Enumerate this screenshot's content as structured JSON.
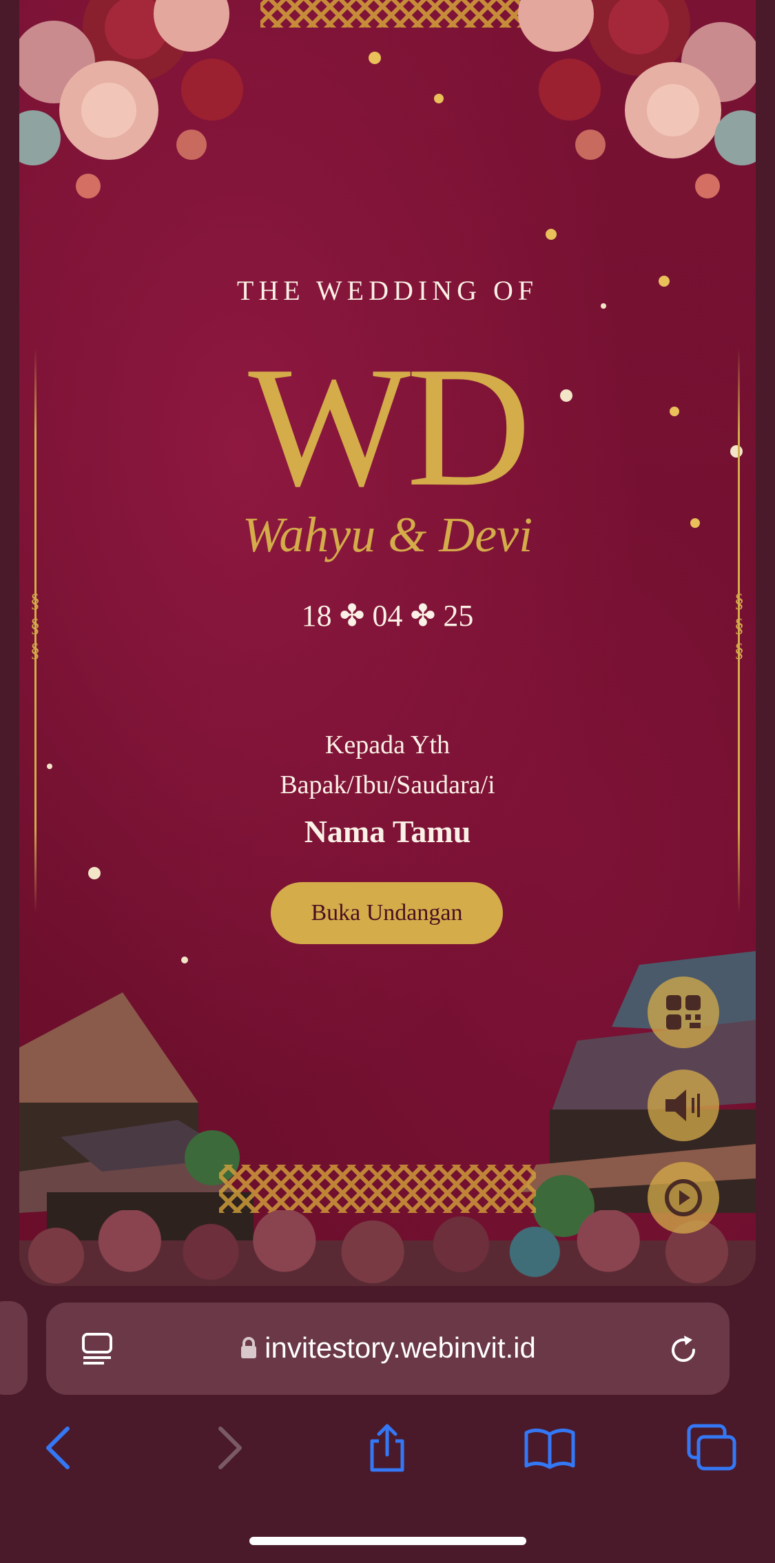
{
  "invitation": {
    "title": "THE WEDDING OF",
    "monogram": "WD",
    "couple_names": "Wahyu & Devi",
    "date": "18 ✤ 04 ✤ 25",
    "recipient_line1": "Kepada Yth",
    "recipient_line2": "Bapak/Ibu/Saudara/i",
    "guest_name": "Nama Tamu",
    "open_button": "Buka Undangan"
  },
  "floating_buttons": [
    "qr-code-icon",
    "speaker-icon",
    "play-icon"
  ],
  "browser": {
    "url": "invitestory.webinvit.id",
    "toolbar": [
      "back-icon",
      "forward-icon",
      "share-icon",
      "bookmarks-icon",
      "tabs-icon"
    ]
  },
  "colors": {
    "background": "#6e0f2d",
    "gold": "#d4ac4a",
    "cream": "#fbf1e6",
    "browser_chrome": "#4a1a2a",
    "accent_blue": "#3478f6"
  }
}
